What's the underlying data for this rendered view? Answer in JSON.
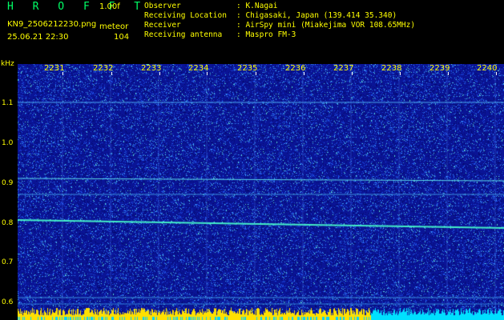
{
  "header": {
    "app_name": "H R O F F T",
    "version": "1.00f",
    "filename": "KN9_2506212230.png",
    "meteor_label": "meteor",
    "datetime": "25.06.21 22:30",
    "meteor_count": "104",
    "info": [
      {
        "key": "Observer",
        "value": ": K.Nagai"
      },
      {
        "key": "Receiving Location",
        "value": ": Chigasaki, Japan (139.414 35.340)"
      },
      {
        "key": "Receiver",
        "value": ": AirSpy mini (Miakejima VOR 108.65MHz)"
      },
      {
        "key": "Receiving antenna",
        "value": ": Maspro FM-3"
      }
    ]
  },
  "axis": {
    "y_unit": "kHz",
    "y_labels": [
      "1.1",
      "1.0",
      "0.9",
      "0.8",
      "0.7",
      "0.6"
    ],
    "x_labels": [
      "2231",
      "2232",
      "2233",
      "2234",
      "2235",
      "2236",
      "2237",
      "2238",
      "2239",
      "2240"
    ]
  },
  "colors": {
    "background": "#000000",
    "text": "#ffff00",
    "logo": "#00ff66",
    "spectrum_base": "#0a14a0",
    "signal_line": "#4ef0d0"
  }
}
